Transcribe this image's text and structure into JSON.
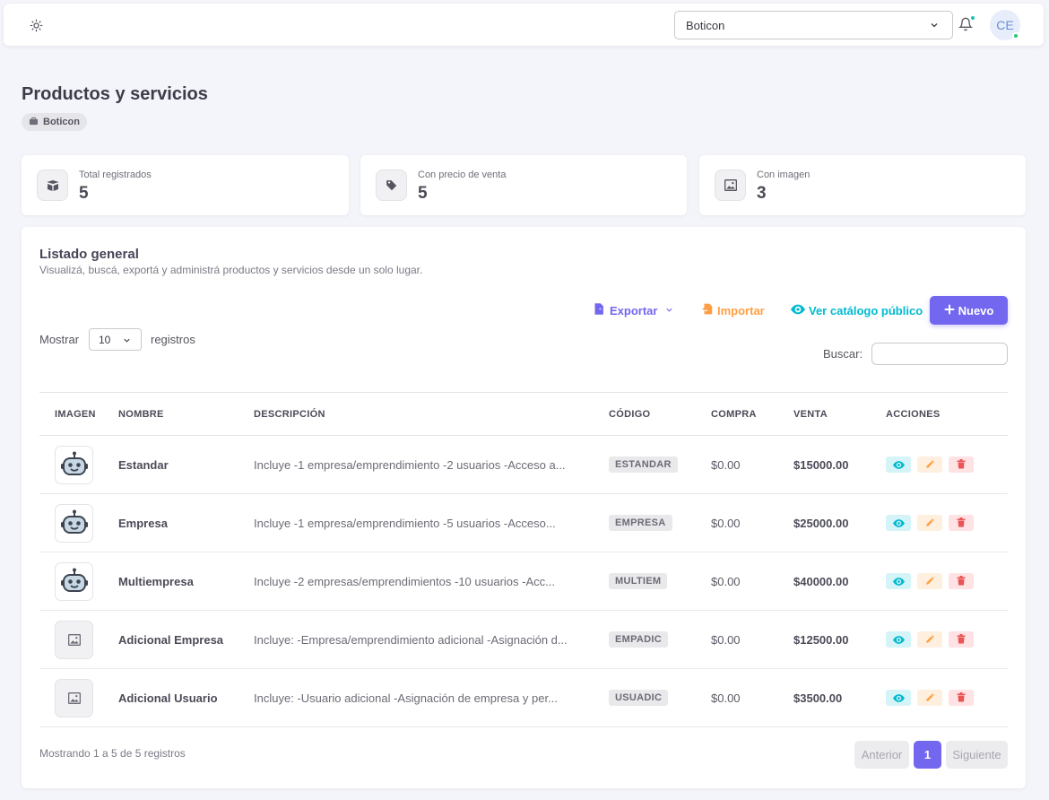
{
  "topbar": {
    "company_selected": "Boticon",
    "avatar_initials": "CE"
  },
  "page": {
    "title": "Productos y servicios",
    "badge": "Boticon"
  },
  "stats": [
    {
      "label": "Total registrados",
      "value": "5",
      "icon": "box-icon"
    },
    {
      "label": "Con precio de venta",
      "value": "5",
      "icon": "tag-icon"
    },
    {
      "label": "Con imagen",
      "value": "3",
      "icon": "image-icon"
    }
  ],
  "listing": {
    "title": "Listado general",
    "subtitle": "Visualizá, buscá, exportá y administrá productos y servicios desde un solo lugar.",
    "export_label": "Exportar",
    "import_label": "Importar",
    "catalog_label": "Ver catálogo público",
    "new_label": "Nuevo",
    "show_label": "Mostrar",
    "page_size": "10",
    "records_label": "registros",
    "search_label": "Buscar:",
    "search_value": ""
  },
  "table": {
    "headers": [
      "IMAGEN",
      "NOMBRE",
      "DESCRIPCIÓN",
      "CÓDIGO",
      "COMPRA",
      "VENTA",
      "ACCIONES"
    ],
    "rows": [
      {
        "image": "robot",
        "name": "Estandar",
        "description": "Incluye -1 empresa/emprendimiento -2 usuarios -Acceso a...",
        "code": "ESTANDAR",
        "purchase": "$0.00",
        "sale": "$15000.00"
      },
      {
        "image": "robot",
        "name": "Empresa",
        "description": "Incluye -1 empresa/emprendimiento -5 usuarios -Acceso...",
        "code": "EMPRESA",
        "purchase": "$0.00",
        "sale": "$25000.00"
      },
      {
        "image": "robot",
        "name": "Multiempresa",
        "description": "Incluye -2 empresas/emprendimientos -10 usuarios -Acc...",
        "code": "MULTIEM",
        "purchase": "$0.00",
        "sale": "$40000.00"
      },
      {
        "image": "placeholder",
        "name": "Adicional Empresa",
        "description": "Incluye: -Empresa/emprendimiento adicional -Asignación d...",
        "code": "EMPADIC",
        "purchase": "$0.00",
        "sale": "$12500.00"
      },
      {
        "image": "placeholder",
        "name": "Adicional Usuario",
        "description": "Incluye: -Usuario adicional -Asignación de empresa y per...",
        "code": "USUADIC",
        "purchase": "$0.00",
        "sale": "$3500.00"
      }
    ]
  },
  "pagination": {
    "info": "Mostrando 1 a 5 de 5 registros",
    "prev_label": "Anterior",
    "current_page": "1",
    "next_label": "Siguiente"
  },
  "colors": {
    "primary": "#7367f0",
    "info": "#00bad1",
    "warning": "#ff9f43",
    "danger": "#ea5455"
  }
}
